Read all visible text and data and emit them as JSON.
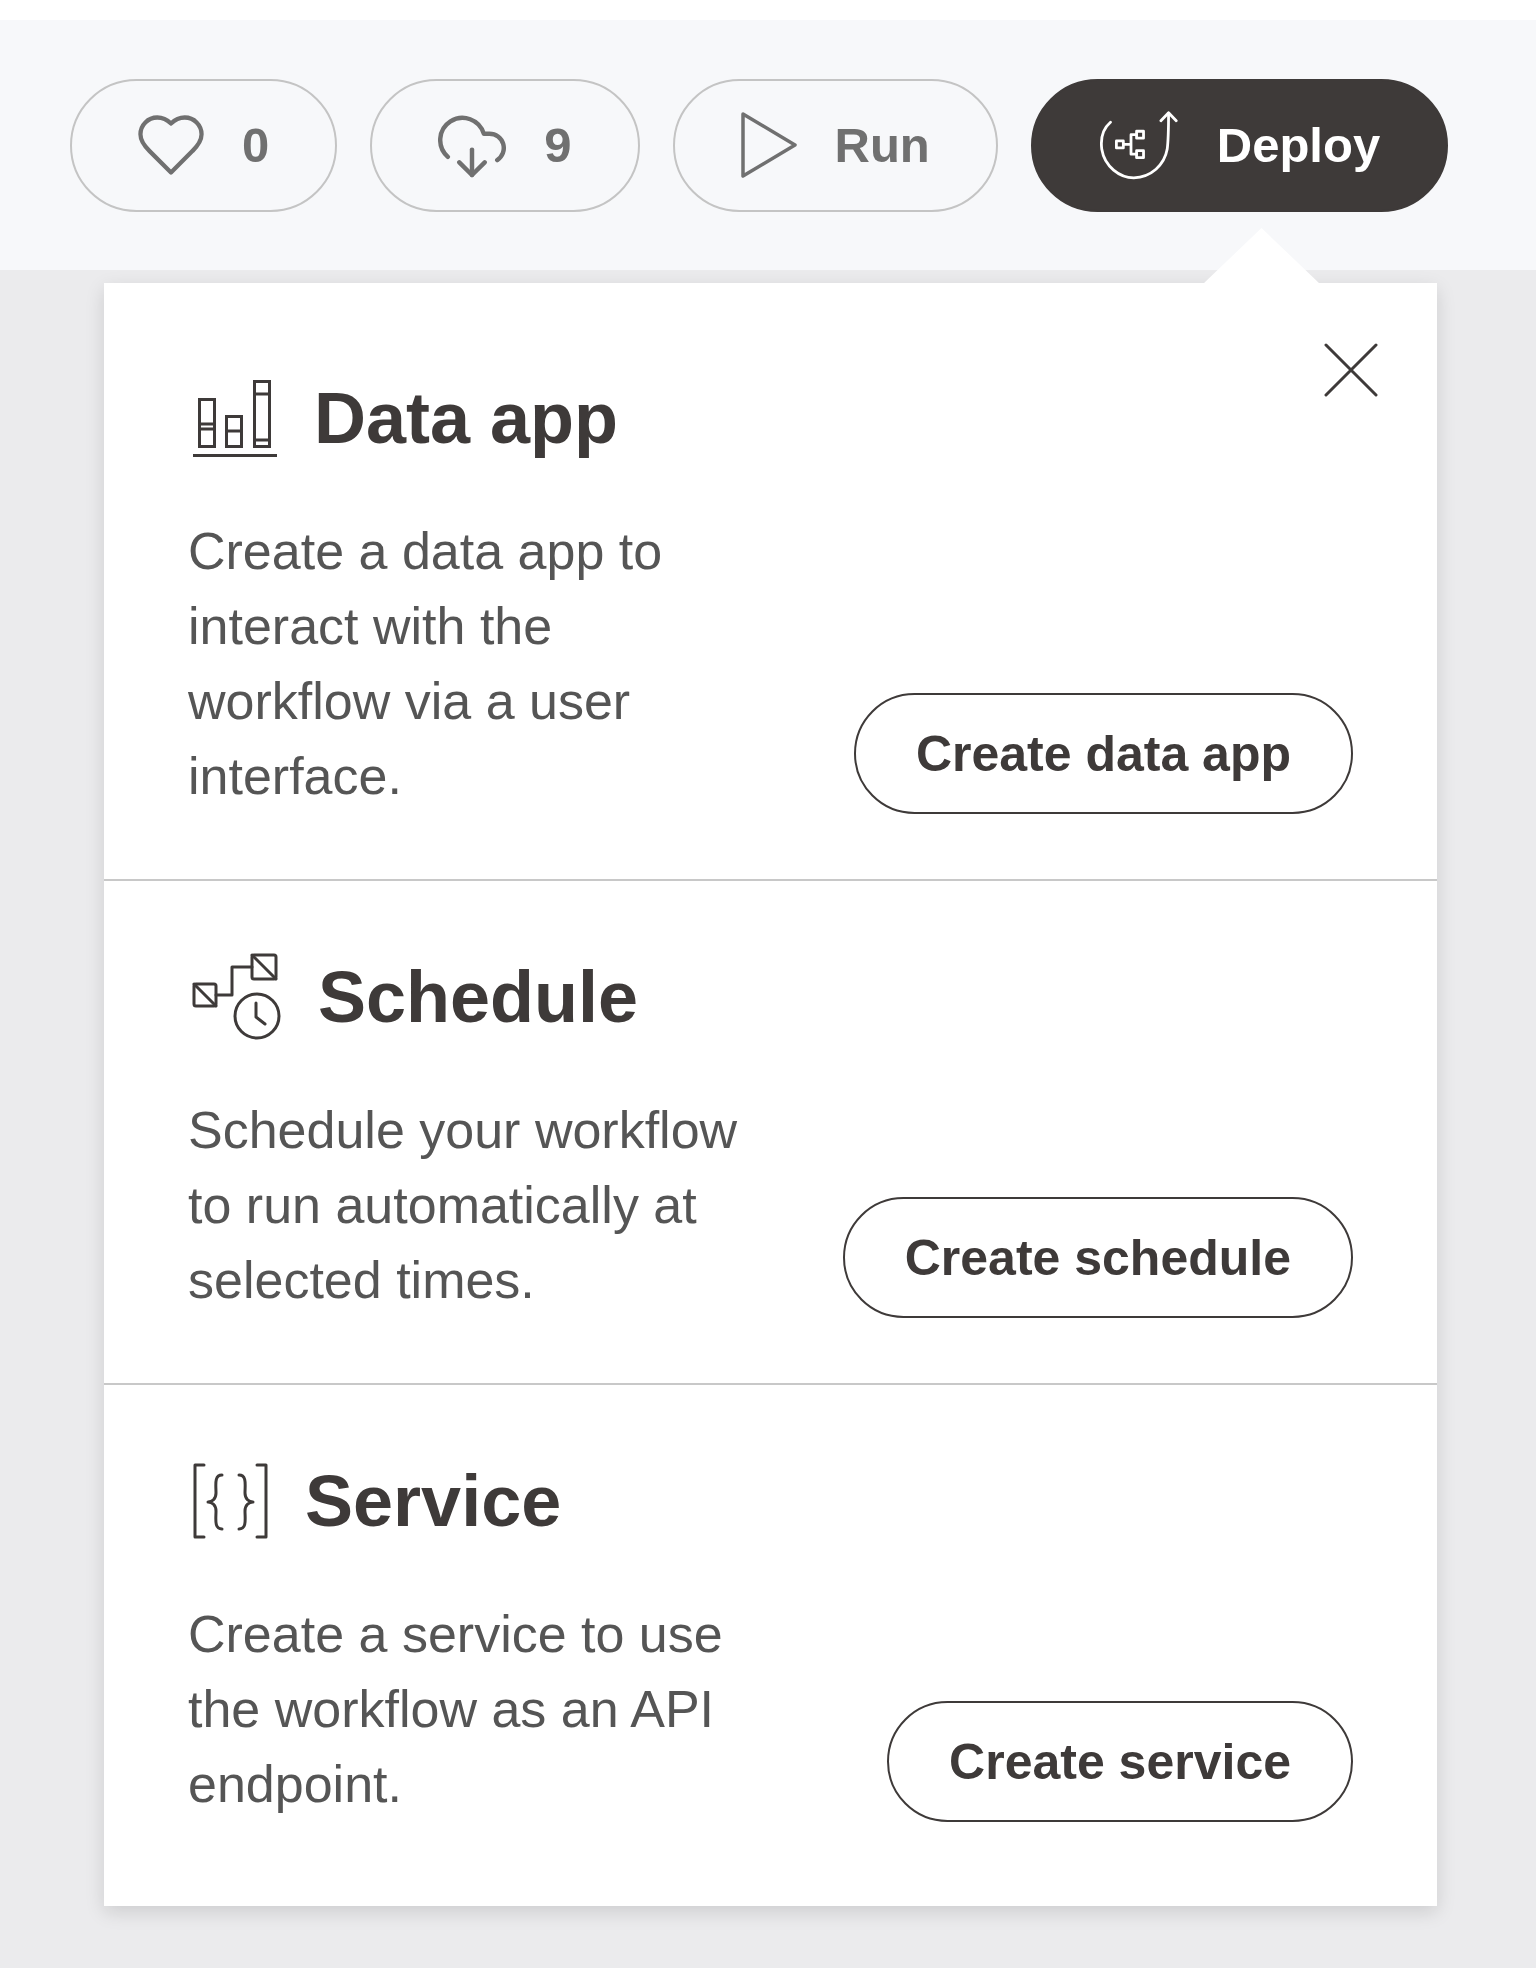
{
  "toolbar": {
    "buttons": [
      {
        "kind": "like",
        "label": "0",
        "expanded": false
      },
      {
        "kind": "download",
        "label": "9",
        "expanded": false
      },
      {
        "kind": "run",
        "label": "Run",
        "expanded": false
      },
      {
        "kind": "deploy",
        "label": "Deploy",
        "expanded": true
      }
    ]
  },
  "deploy_popover": {
    "sections": [
      {
        "kind": "data_app",
        "title": "Data app",
        "description": "Create a data app to interact with the workflow via a user interface.",
        "button": "Create data app"
      },
      {
        "kind": "schedule",
        "title": "Schedule",
        "description": "Schedule your workflow to run automatically at selected times.",
        "button": "Create schedule"
      },
      {
        "kind": "service",
        "title": "Service",
        "description": "Create a service to use the workflow as an API endpoint.",
        "button": "Create service"
      }
    ]
  }
}
